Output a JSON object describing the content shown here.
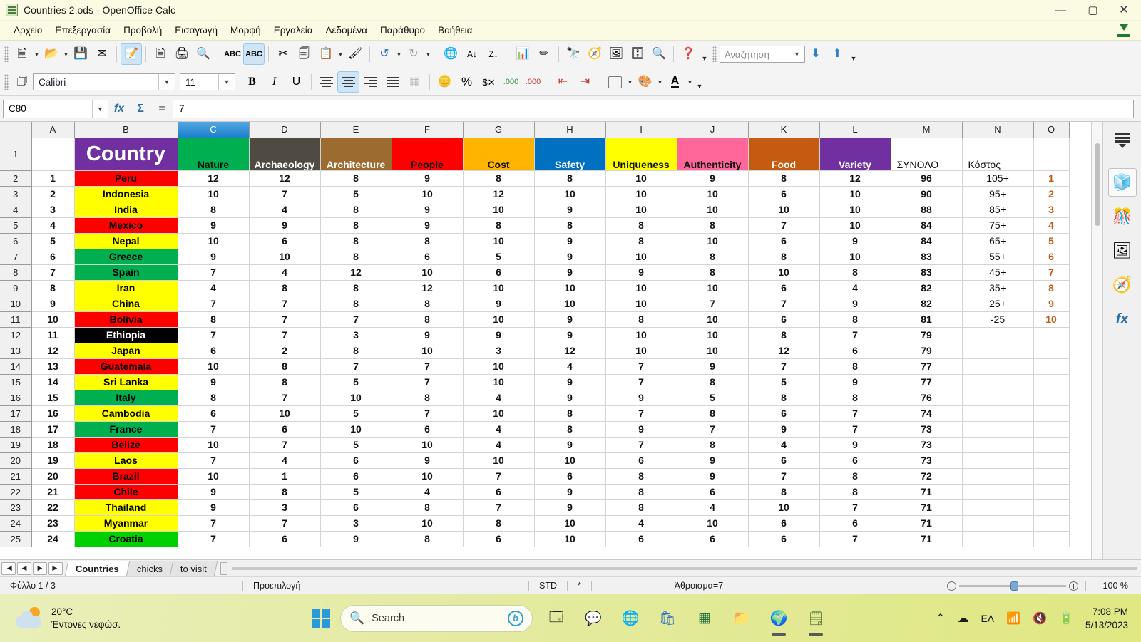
{
  "window": {
    "title": "Countries 2.ods - OpenOffice Calc",
    "app_icon": "calc-document-icon",
    "minimize": "—",
    "maximize": "▢",
    "close": "✕"
  },
  "menubar": {
    "items": [
      "Αρχείο",
      "Επεξεργασία",
      "Προβολή",
      "Εισαγωγή",
      "Μορφή",
      "Εργαλεία",
      "Δεδομένα",
      "Παράθυρο",
      "Βοήθεια"
    ],
    "right_icon": "download-icon"
  },
  "toolbar_standard": {
    "buttons": [
      "new-document-icon",
      "open-icon",
      "save-icon",
      "email-icon",
      "edit-file-icon",
      "export-pdf-icon",
      "print-icon",
      "print-preview-icon",
      "spelling-icon",
      "autospellcheck-icon",
      "cut-icon",
      "copy-icon",
      "paste-icon",
      "clone-formatting-icon",
      "undo-icon",
      "redo-icon",
      "hyperlink-icon",
      "sort-ascending-icon",
      "sort-descending-icon",
      "chart-icon",
      "draw-functions-icon",
      "find-replace-icon",
      "navigator-icon",
      "gallery-icon",
      "data-sources-icon",
      "zoom-icon",
      "help-icon"
    ],
    "search": {
      "placeholder": "Αναζήτηση",
      "find-next": "find-next-icon",
      "find-previous": "find-previous-icon"
    }
  },
  "toolbar_format": {
    "styles_icon": "styles-and-formatting-icon",
    "font_name": "Calibri",
    "font_size": "11",
    "bold": "B",
    "italic": "I",
    "underline": "U",
    "align": [
      "align-left-icon",
      "align-center-icon",
      "align-right-icon",
      "align-justified-icon"
    ],
    "active_align": "align-center-icon",
    "merge_cells": "merge-cells-icon",
    "currency": "currency-format-icon",
    "percent": "%",
    "number_format": "number-format-icon",
    "add_decimal": "add-decimal-icon",
    "delete_decimal": "delete-decimal-icon",
    "decrease_indent": "decrease-indent-icon",
    "increase_indent": "increase-indent-icon",
    "borders": "borders-icon",
    "background_color": "background-color-icon",
    "font_color": "font-color-icon"
  },
  "formula_bar": {
    "name_box": "C80",
    "function_wizard": "fx",
    "sum": "Σ",
    "equals": "=",
    "input_line": "7"
  },
  "spreadsheet": {
    "columns": [
      "A",
      "B",
      "C",
      "D",
      "E",
      "F",
      "G",
      "H",
      "I",
      "J",
      "K",
      "L",
      "M",
      "N",
      "O"
    ],
    "selected_column": "C",
    "row_numbers": [
      1,
      2,
      3,
      4,
      5,
      6,
      7,
      8,
      9,
      10,
      11,
      12,
      13,
      14,
      15,
      16,
      17,
      18,
      19,
      20,
      21,
      22,
      23,
      24,
      25
    ],
    "header_row": {
      "a": "",
      "b": "Country",
      "labels": [
        "Nature",
        "Archaeology",
        "Architecture",
        "People",
        "Cost",
        "Safety",
        "Uniqueness",
        "Authenticity",
        "Food",
        "Variety"
      ],
      "total": "ΣΥΝΟΛΟ",
      "cost": "Κόστος",
      "colors": {
        "country": "#7030a0",
        "nature": "#00b050",
        "archaeology": "#4f4a42",
        "architecture": "#9c6b30",
        "people": "#ff0000",
        "cost": "#ffb400",
        "safety": "#0070c0",
        "uniqueness": "#ffff00",
        "authenticity": "#ff669a",
        "food": "#c55a11",
        "variety": "#7030a0"
      }
    },
    "rows": [
      {
        "rank": "1",
        "country": "Peru",
        "fill": "#ff0000",
        "fg": "#000000",
        "v": [
          12,
          12,
          8,
          9,
          8,
          8,
          10,
          9,
          8,
          12
        ],
        "total": "96",
        "cost": "105+",
        "o": "1"
      },
      {
        "rank": "2",
        "country": "Indonesia",
        "fill": "#ffff00",
        "fg": "#000000",
        "v": [
          10,
          7,
          5,
          10,
          12,
          10,
          10,
          10,
          6,
          10
        ],
        "total": "90",
        "cost": "95+",
        "o": "2"
      },
      {
        "rank": "3",
        "country": "India",
        "fill": "#ffff00",
        "fg": "#000000",
        "v": [
          8,
          4,
          8,
          9,
          10,
          9,
          10,
          10,
          10,
          10
        ],
        "total": "88",
        "cost": "85+",
        "o": "3"
      },
      {
        "rank": "4",
        "country": "Mexico",
        "fill": "#ff0000",
        "fg": "#000000",
        "v": [
          9,
          9,
          8,
          9,
          8,
          8,
          8,
          8,
          7,
          10
        ],
        "total": "84",
        "cost": "75+",
        "o": "4"
      },
      {
        "rank": "5",
        "country": "Nepal",
        "fill": "#ffff00",
        "fg": "#000000",
        "v": [
          10,
          6,
          8,
          8,
          10,
          9,
          8,
          10,
          6,
          9
        ],
        "total": "84",
        "cost": "65+",
        "o": "5"
      },
      {
        "rank": "6",
        "country": "Greece",
        "fill": "#00b050",
        "fg": "#000000",
        "v": [
          9,
          10,
          8,
          6,
          5,
          9,
          10,
          8,
          8,
          10
        ],
        "total": "83",
        "cost": "55+",
        "o": "6"
      },
      {
        "rank": "7",
        "country": "Spain",
        "fill": "#00b050",
        "fg": "#000000",
        "v": [
          7,
          4,
          12,
          10,
          6,
          9,
          9,
          8,
          10,
          8
        ],
        "total": "83",
        "cost": "45+",
        "o": "7"
      },
      {
        "rank": "8",
        "country": "Iran",
        "fill": "#ffff00",
        "fg": "#000000",
        "v": [
          4,
          8,
          8,
          12,
          10,
          10,
          10,
          10,
          6,
          4
        ],
        "total": "82",
        "cost": "35+",
        "o": "8"
      },
      {
        "rank": "9",
        "country": "China",
        "fill": "#ffff00",
        "fg": "#000000",
        "v": [
          7,
          7,
          8,
          8,
          9,
          10,
          10,
          7,
          7,
          9
        ],
        "total": "82",
        "cost": "25+",
        "o": "9"
      },
      {
        "rank": "10",
        "country": "Bolivia",
        "fill": "#ff0000",
        "fg": "#000000",
        "v": [
          8,
          7,
          7,
          8,
          10,
          9,
          8,
          10,
          6,
          8
        ],
        "total": "81",
        "cost": "-25",
        "o": "10"
      },
      {
        "rank": "11",
        "country": "Ethiopia",
        "fill": "#000000",
        "fg": "#ffffff",
        "v": [
          7,
          7,
          3,
          9,
          9,
          9,
          10,
          10,
          8,
          7
        ],
        "total": "79",
        "cost": "",
        "o": ""
      },
      {
        "rank": "12",
        "country": "Japan",
        "fill": "#ffff00",
        "fg": "#000000",
        "v": [
          6,
          2,
          8,
          10,
          3,
          12,
          10,
          10,
          12,
          6
        ],
        "total": "79",
        "cost": "",
        "o": ""
      },
      {
        "rank": "13",
        "country": "Guatemala",
        "fill": "#ff0000",
        "fg": "#000000",
        "v": [
          10,
          8,
          7,
          7,
          10,
          4,
          7,
          9,
          7,
          8
        ],
        "total": "77",
        "cost": "",
        "o": ""
      },
      {
        "rank": "14",
        "country": "Sri Lanka",
        "fill": "#ffff00",
        "fg": "#000000",
        "v": [
          9,
          8,
          5,
          7,
          10,
          9,
          7,
          8,
          5,
          9
        ],
        "total": "77",
        "cost": "",
        "o": ""
      },
      {
        "rank": "15",
        "country": "Italy",
        "fill": "#00b050",
        "fg": "#000000",
        "v": [
          8,
          7,
          10,
          8,
          4,
          9,
          9,
          5,
          8,
          8
        ],
        "total": "76",
        "cost": "",
        "o": ""
      },
      {
        "rank": "16",
        "country": "Cambodia",
        "fill": "#ffff00",
        "fg": "#000000",
        "v": [
          6,
          10,
          5,
          7,
          10,
          8,
          7,
          8,
          6,
          7
        ],
        "total": "74",
        "cost": "",
        "o": ""
      },
      {
        "rank": "17",
        "country": "France",
        "fill": "#00b050",
        "fg": "#000000",
        "v": [
          7,
          6,
          10,
          6,
          4,
          8,
          9,
          7,
          9,
          7
        ],
        "total": "73",
        "cost": "",
        "o": ""
      },
      {
        "rank": "18",
        "country": "Belize",
        "fill": "#ff0000",
        "fg": "#000000",
        "v": [
          10,
          7,
          5,
          10,
          4,
          9,
          7,
          8,
          4,
          9
        ],
        "total": "73",
        "cost": "",
        "o": ""
      },
      {
        "rank": "19",
        "country": "Laos",
        "fill": "#ffff00",
        "fg": "#000000",
        "v": [
          7,
          4,
          6,
          9,
          10,
          10,
          6,
          9,
          6,
          6
        ],
        "total": "73",
        "cost": "",
        "o": ""
      },
      {
        "rank": "20",
        "country": "Brazil",
        "fill": "#ff0000",
        "fg": "#000000",
        "v": [
          10,
          1,
          6,
          10,
          7,
          6,
          8,
          9,
          7,
          8
        ],
        "total": "72",
        "cost": "",
        "o": ""
      },
      {
        "rank": "21",
        "country": "Chile",
        "fill": "#ff0000",
        "fg": "#000000",
        "v": [
          9,
          8,
          5,
          4,
          6,
          9,
          8,
          6,
          8,
          8
        ],
        "total": "71",
        "cost": "",
        "o": ""
      },
      {
        "rank": "22",
        "country": "Thailand",
        "fill": "#ffff00",
        "fg": "#000000",
        "v": [
          9,
          3,
          6,
          8,
          7,
          9,
          8,
          4,
          10,
          7
        ],
        "total": "71",
        "cost": "",
        "o": ""
      },
      {
        "rank": "23",
        "country": "Myanmar",
        "fill": "#ffff00",
        "fg": "#000000",
        "v": [
          7,
          7,
          3,
          10,
          8,
          10,
          4,
          10,
          6,
          6
        ],
        "total": "71",
        "cost": "",
        "o": ""
      },
      {
        "rank": "24",
        "country": "Croatia",
        "fill": "#00d000",
        "fg": "#000000",
        "v": [
          7,
          6,
          9,
          8,
          6,
          10,
          6,
          6,
          6,
          7
        ],
        "total": "71",
        "cost": "",
        "o": ""
      }
    ]
  },
  "sidebar": {
    "menu_icon": "sidebar-settings-icon",
    "items": [
      {
        "name": "properties-icon",
        "active": true
      },
      {
        "name": "styles-and-formatting-icon",
        "active": false
      },
      {
        "name": "gallery-icon",
        "active": false
      },
      {
        "name": "navigator-icon",
        "active": false
      },
      {
        "name": "functions-icon",
        "active": false
      }
    ]
  },
  "sheet_tabs": {
    "nav": [
      "first-sheet-icon",
      "previous-sheet-icon",
      "next-sheet-icon",
      "last-sheet-icon"
    ],
    "tabs": [
      {
        "label": "Countries",
        "active": true
      },
      {
        "label": "chicks",
        "active": false
      },
      {
        "label": "to visit",
        "active": false
      }
    ]
  },
  "status_bar": {
    "sheet": "Φύλλο 1 / 3",
    "page_style": "Προεπιλογή",
    "insert_mode": "STD",
    "modified": "*",
    "sum": "Άθροισμα=7",
    "zoom_out": "zoom-out-icon",
    "zoom_in": "zoom-in-icon",
    "zoom_level": "100 %"
  },
  "taskbar": {
    "weather": {
      "temp": "20°C",
      "desc": "Έντονες νεφώσ."
    },
    "start": "windows-start-icon",
    "search": {
      "placeholder": "Search",
      "icon": "search-icon",
      "copilot": "bing-icon"
    },
    "apps": [
      "task-view-icon",
      "chat-icon",
      "edge-icon",
      "store-icon",
      "excel-icon",
      "file-explorer-icon",
      "chrome-icon",
      "calc-icon"
    ],
    "tray": {
      "show_hidden": "chevron-up-icon",
      "cloud": "onedrive-icon",
      "language": "ΕΛ",
      "wifi": "wifi-icon",
      "volume": "volume-muted-icon",
      "battery": "battery-charging-icon"
    },
    "clock": {
      "time": "7:08 PM",
      "date": "5/13/2023"
    }
  }
}
